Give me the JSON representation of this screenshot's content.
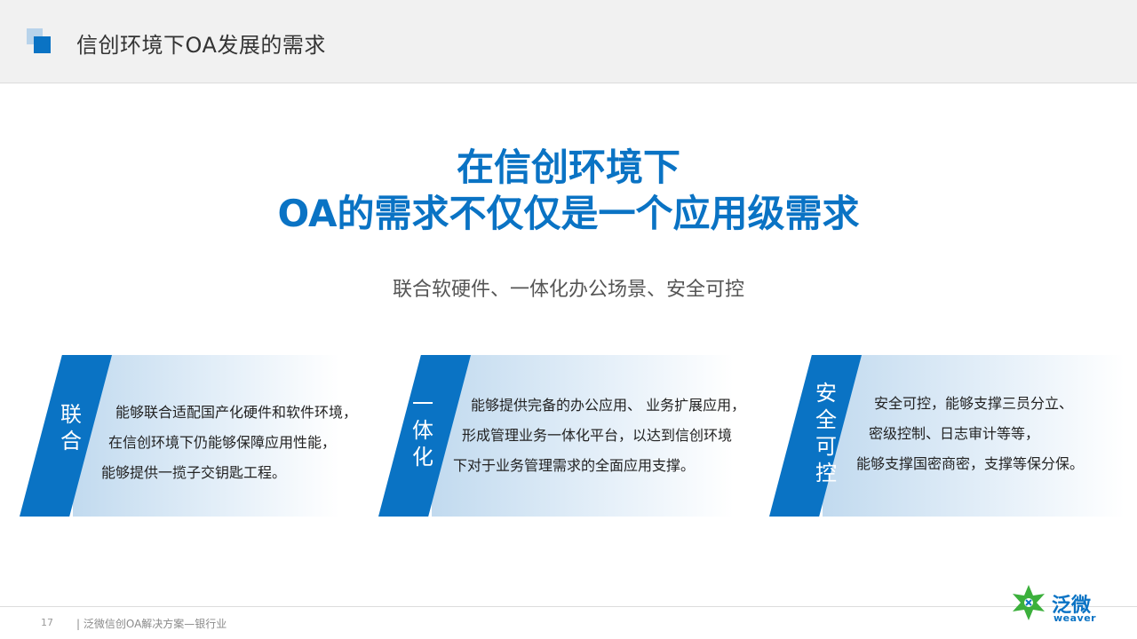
{
  "header": {
    "title": "信创环境下OA发展的需求"
  },
  "headline": {
    "line1": "在信创环境下",
    "line2": "OA的需求不仅仅是一个应用级需求"
  },
  "subline": "联合软硬件、一体化办公场景、安全可控",
  "cards": [
    {
      "label_chars": [
        "联",
        "合"
      ],
      "lines": [
        "能够联合适配国产化硬件和软件环境，",
        "在信创环境下仍能够保障应用性能，",
        "能够提供一揽子交钥匙工程。"
      ]
    },
    {
      "label_chars": [
        "一",
        "体",
        "化"
      ],
      "lines": [
        "能够提供完备的办公应用、 业务扩展应用，",
        "形成管理业务一体化平台，以达到信创环境",
        "下对于业务管理需求的全面应用支撑。"
      ]
    },
    {
      "label_chars": [
        "安",
        "全",
        "可",
        "控"
      ],
      "lines": [
        "安全可控，能够支撑三员分立、",
        "密级控制、日志审计等等，",
        "能够支撑国密商密，支撑等保分保。"
      ]
    }
  ],
  "footer": {
    "page_number": "17",
    "text": "| 泛微信创OA解决方案—银行业"
  },
  "logo": {
    "cn": "泛微",
    "en": "weaver",
    "icon": "weaver-logo-icon"
  },
  "colors": {
    "accent": "#0a73c4",
    "logo_green": "#3cb03c"
  }
}
